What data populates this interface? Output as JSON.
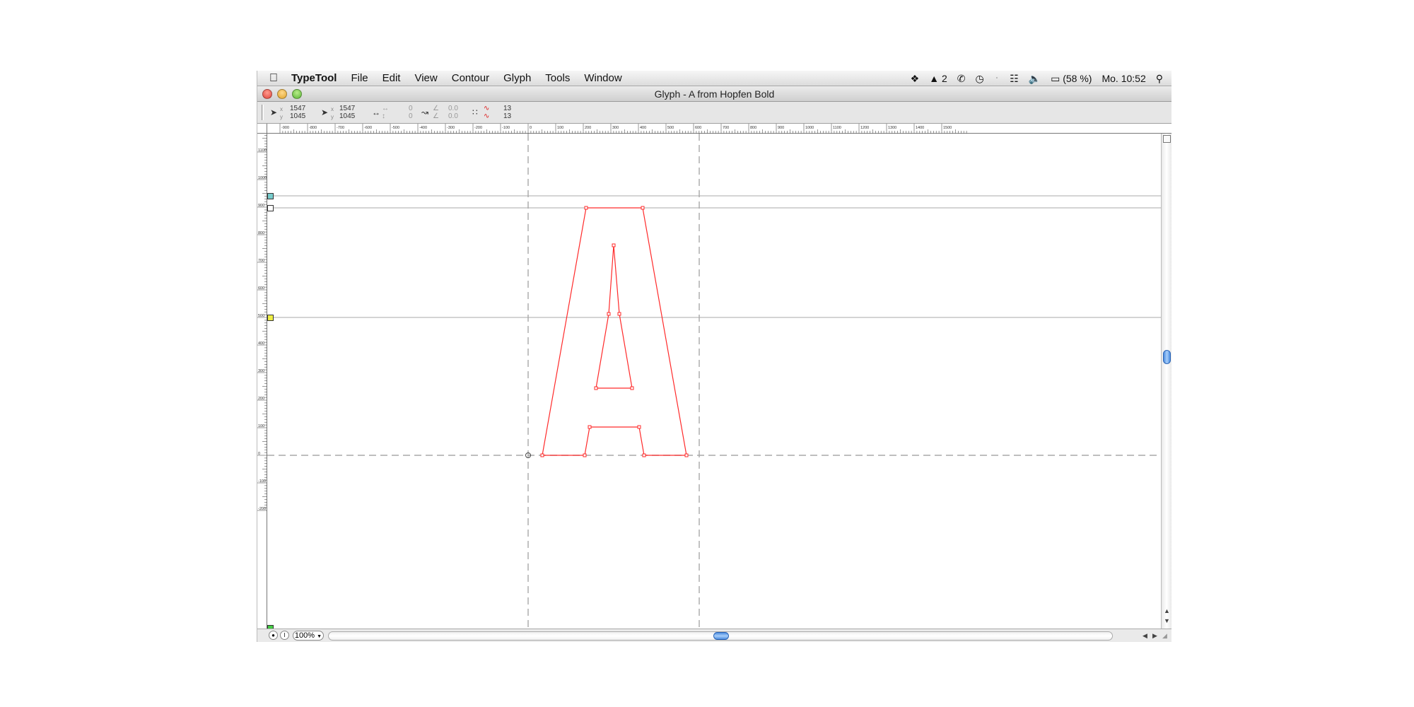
{
  "menubar": {
    "app": "TypeTool",
    "items": [
      "File",
      "Edit",
      "View",
      "Contour",
      "Glyph",
      "Tools",
      "Window"
    ],
    "status": {
      "adobe_count": "2",
      "battery": "(58 %)",
      "clock": "Mo. 10:52"
    }
  },
  "window": {
    "title": "Glyph - A from Hopfen Bold"
  },
  "toolbar": {
    "cursor_x": "1547",
    "cursor_y": "1045",
    "node_x": "1547",
    "node_y": "1045",
    "dist_w": "0",
    "dist_h": "0",
    "angle_a": "0.0",
    "angle_b": "0.0",
    "nodes_a": "13",
    "nodes_b": "13",
    "label_x": "x",
    "label_y": "y"
  },
  "rulers": {
    "h_labels": [
      "-900",
      "-800",
      "-700",
      "-600",
      "-500",
      "-400",
      "-300",
      "-200",
      "-100",
      "0",
      "100",
      "200",
      "300",
      "400",
      "500",
      "600",
      "700",
      "800",
      "900",
      "1000",
      "1100",
      "1200",
      "1300",
      "1400",
      "1500"
    ],
    "v_labels": [
      "1100",
      "1000",
      "900",
      "800",
      "700",
      "600",
      "500",
      "400",
      "300",
      "200",
      "100",
      "0",
      "-100",
      "-200"
    ]
  },
  "statusbar": {
    "zoom": "100%"
  },
  "colors": {
    "outline": "#ff2a2a",
    "guide": "#a8a8a8"
  }
}
